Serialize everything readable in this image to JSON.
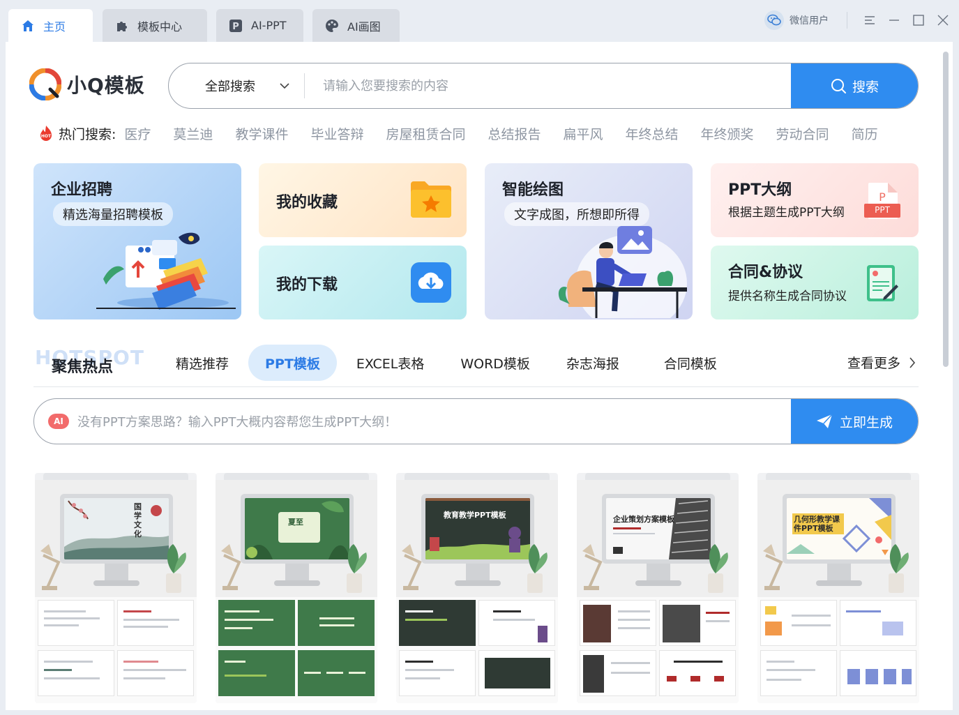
{
  "tabs": [
    {
      "label": "主页",
      "icon": "home-icon",
      "active": true
    },
    {
      "label": "模板中心",
      "icon": "puzzle-icon",
      "active": false
    },
    {
      "label": "AI-PPT",
      "icon": "ppt-icon",
      "active": false
    },
    {
      "label": "AI画图",
      "icon": "palette-icon",
      "active": false
    }
  ],
  "user": {
    "name": "微信用户",
    "icon": "wechat-icon"
  },
  "window": {
    "menu": "menu-icon",
    "minimize": "minimize-icon",
    "maximize": "maximize-icon",
    "close": "close-icon"
  },
  "logo": {
    "name": "小Q模板"
  },
  "search": {
    "scope": "全部搜索",
    "placeholder": "请输入您要搜索的内容",
    "button": "搜索"
  },
  "hot": {
    "label": "热门搜索:",
    "keywords": [
      "医疗",
      "莫兰迪",
      "教学课件",
      "毕业答辩",
      "房屋租赁合同",
      "总结报告",
      "扁平风",
      "年终总结",
      "年终颁奖",
      "劳动合同",
      "简历"
    ]
  },
  "cards": {
    "recruit": {
      "title": "企业招聘",
      "subtitle": "精选海量招聘模板"
    },
    "favorites": {
      "title": "我的收藏"
    },
    "downloads": {
      "title": "我的下载"
    },
    "drawing": {
      "title": "智能绘图",
      "subtitle": "文字成图，所想即所得"
    },
    "outline": {
      "title": "PPT大纲",
      "subtitle": "根据主题生成PPT大纲",
      "badge": "PPT"
    },
    "contract": {
      "title": "合同&协议",
      "subtitle": "提供名称生成合同协议"
    }
  },
  "section": {
    "bg_text": "HOTSPOT",
    "title": "聚焦热点",
    "tabs": [
      "精选推荐",
      "PPT模板",
      "EXCEL表格",
      "WORD模板",
      "杂志海报",
      "合同模板"
    ],
    "active_tab": "PPT模板",
    "more": "查看更多"
  },
  "ai": {
    "badge": "AI",
    "placeholder": "没有PPT方案思路？输入PPT大概内容帮您生成PPT大纲！",
    "button": "立即生成"
  },
  "thumbnails": [
    {
      "screen_title": "国学文化",
      "theme": "#e8eef0",
      "accent": "#c4474a"
    },
    {
      "screen_title": "夏至",
      "theme": "#3f7a4a",
      "accent": "#e9f2d8"
    },
    {
      "screen_title": "教育教学PPT模板",
      "theme": "#2f3a34",
      "accent": "#ffffff"
    },
    {
      "screen_title": "企业策划方案模板",
      "theme": "#f7f7f7",
      "accent": "#b02b2b"
    },
    {
      "screen_title": "几何形教学课件PPT模板",
      "theme": "#fdfbf5",
      "accent": "#f2c94c"
    }
  ]
}
